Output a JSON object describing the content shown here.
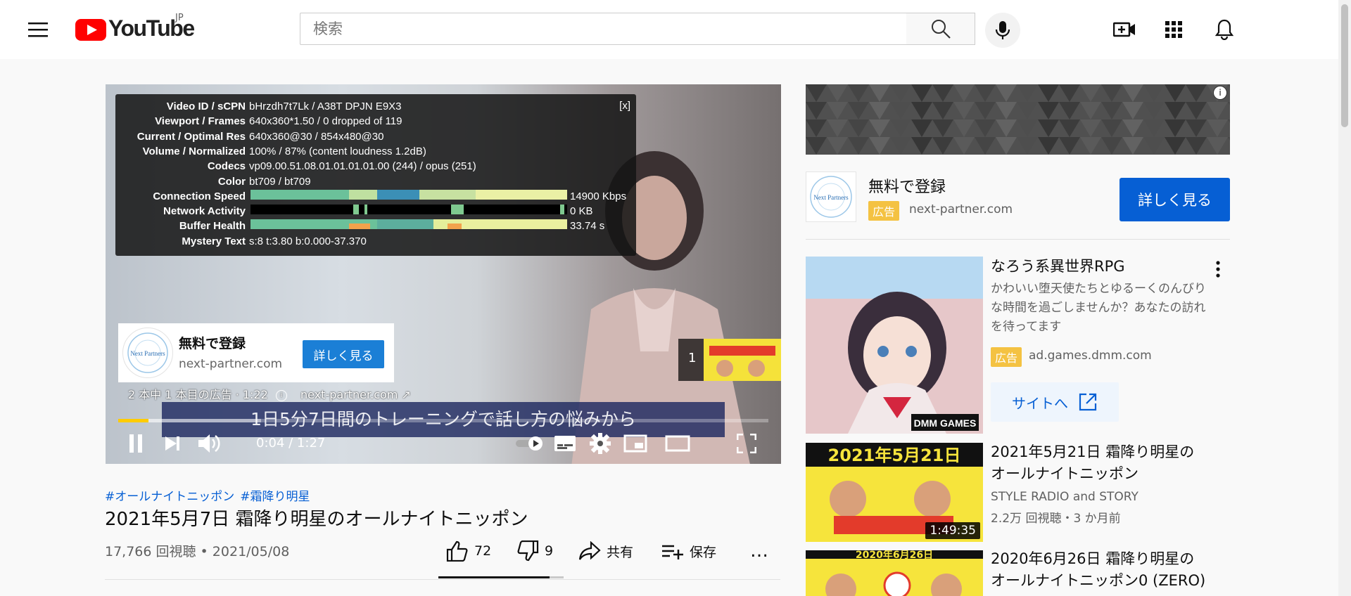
{
  "header": {
    "logo_text": "YouTube",
    "country": "JP",
    "search_placeholder": "検索"
  },
  "stats": {
    "close": "[x]",
    "rows": [
      {
        "key": "Video ID / sCPN",
        "value": "bHrzdh7t7Lk / A38T DPJN E9X3"
      },
      {
        "key": "Viewport / Frames",
        "value": "640x360*1.50 / 0 dropped of 119"
      },
      {
        "key": "Current / Optimal Res",
        "value": "640x360@30 / 854x480@30"
      },
      {
        "key": "Volume / Normalized",
        "value": "100% / 87% (content loudness 1.2dB)"
      },
      {
        "key": "Codecs",
        "value": "vp09.00.51.08.01.01.01.01.00 (244) / opus (251)"
      },
      {
        "key": "Color",
        "value": "bt709 / bt709"
      },
      {
        "key": "Connection Speed",
        "value": "14900 Kbps"
      },
      {
        "key": "Network Activity",
        "value": "0 KB"
      },
      {
        "key": "Buffer Health",
        "value": "33.74 s"
      },
      {
        "key": "Mystery Text",
        "value": "s:8 t:3.80 b:0.000-37.370"
      }
    ]
  },
  "player_ad": {
    "logo_text": "Next Partners",
    "title": "無料で登録",
    "domain": "next-partner.com",
    "button": "詳しく見る",
    "info": "2 本中 1 本目の広告 · 1:22",
    "info_domain": "next-partner.com"
  },
  "preview": {
    "count": "1"
  },
  "subtitle": "1日5分7日間のトレーニングで話し方の悩みから",
  "player": {
    "time": "0:04 / 1:27",
    "progress": 0.046
  },
  "video": {
    "tags": [
      "#オールナイトニッポン",
      "#霜降り明星"
    ],
    "title": "2021年5月7日 霜降り明星のオールナイトニッポン",
    "views": "17,766 回視聴 • 2021/05/08",
    "likes": "72",
    "dislikes": "9",
    "like_ratio": 0.89,
    "share": "共有",
    "save": "保存",
    "more": "…"
  },
  "sidebar": {
    "ad": {
      "logo_text": "Next Partners",
      "title": "無料で登録",
      "badge": "広告",
      "domain": "next-partner.com",
      "button": "詳しく見る"
    },
    "game_ad": {
      "title": "なろう系異世界RPG",
      "desc": "かわいい堕天使たちとゆるーくのんびりな時間を過ごしませんか？あなたの訪れを待ってます",
      "badge": "広告",
      "domain": "ad.games.dmm.com",
      "button": "サイトへ",
      "thumb_label": "DMM GAMES"
    },
    "videos": [
      {
        "title": "2021年5月21日 霜降り明星のオールナイトニッポン",
        "channel": "STYLE RADIO and STORY",
        "meta": "2.2万 回視聴・3 か月前",
        "duration": "1:49:35",
        "thumb_text": "2021年5月21日"
      },
      {
        "title": "2020年6月26日 霜降り明星のオールナイトニッポン0 (ZERO)",
        "thumb_text": "2020年6月26日"
      }
    ]
  },
  "colors": {
    "accent_red": "#ff0000",
    "link_blue": "#065fd4",
    "ad_yellow": "#f4c242",
    "progress_yellow": "#ffcc00"
  }
}
